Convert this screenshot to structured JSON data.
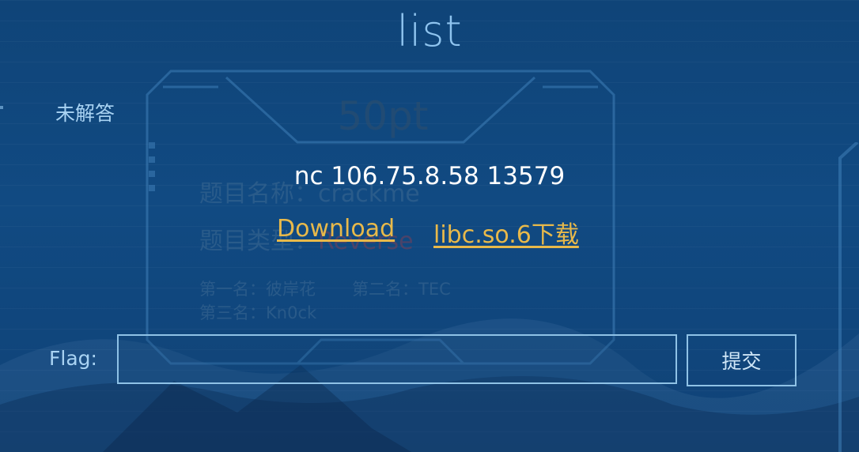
{
  "page": {
    "title": "list",
    "status_label": "未解答"
  },
  "challenge": {
    "points": "50pt",
    "name_text": "题目名称：crackme",
    "type_label": "题目类型：",
    "type_value": "Reverse",
    "rank_first": "第一名：彼岸花",
    "rank_second": "第二名：TEC",
    "rank_third": "第三名：Kn0ck",
    "nc_info": "nc 106.75.8.58 13579",
    "download_label": "Download",
    "libc_label": "libc.so.6下载"
  },
  "flag_form": {
    "label": "Flag:",
    "value": "",
    "submit_label": "提交"
  },
  "colors": {
    "background": "#114a82",
    "title": "#8fc4ef",
    "link": "#e8b94a",
    "border": "#8fc2e6"
  }
}
